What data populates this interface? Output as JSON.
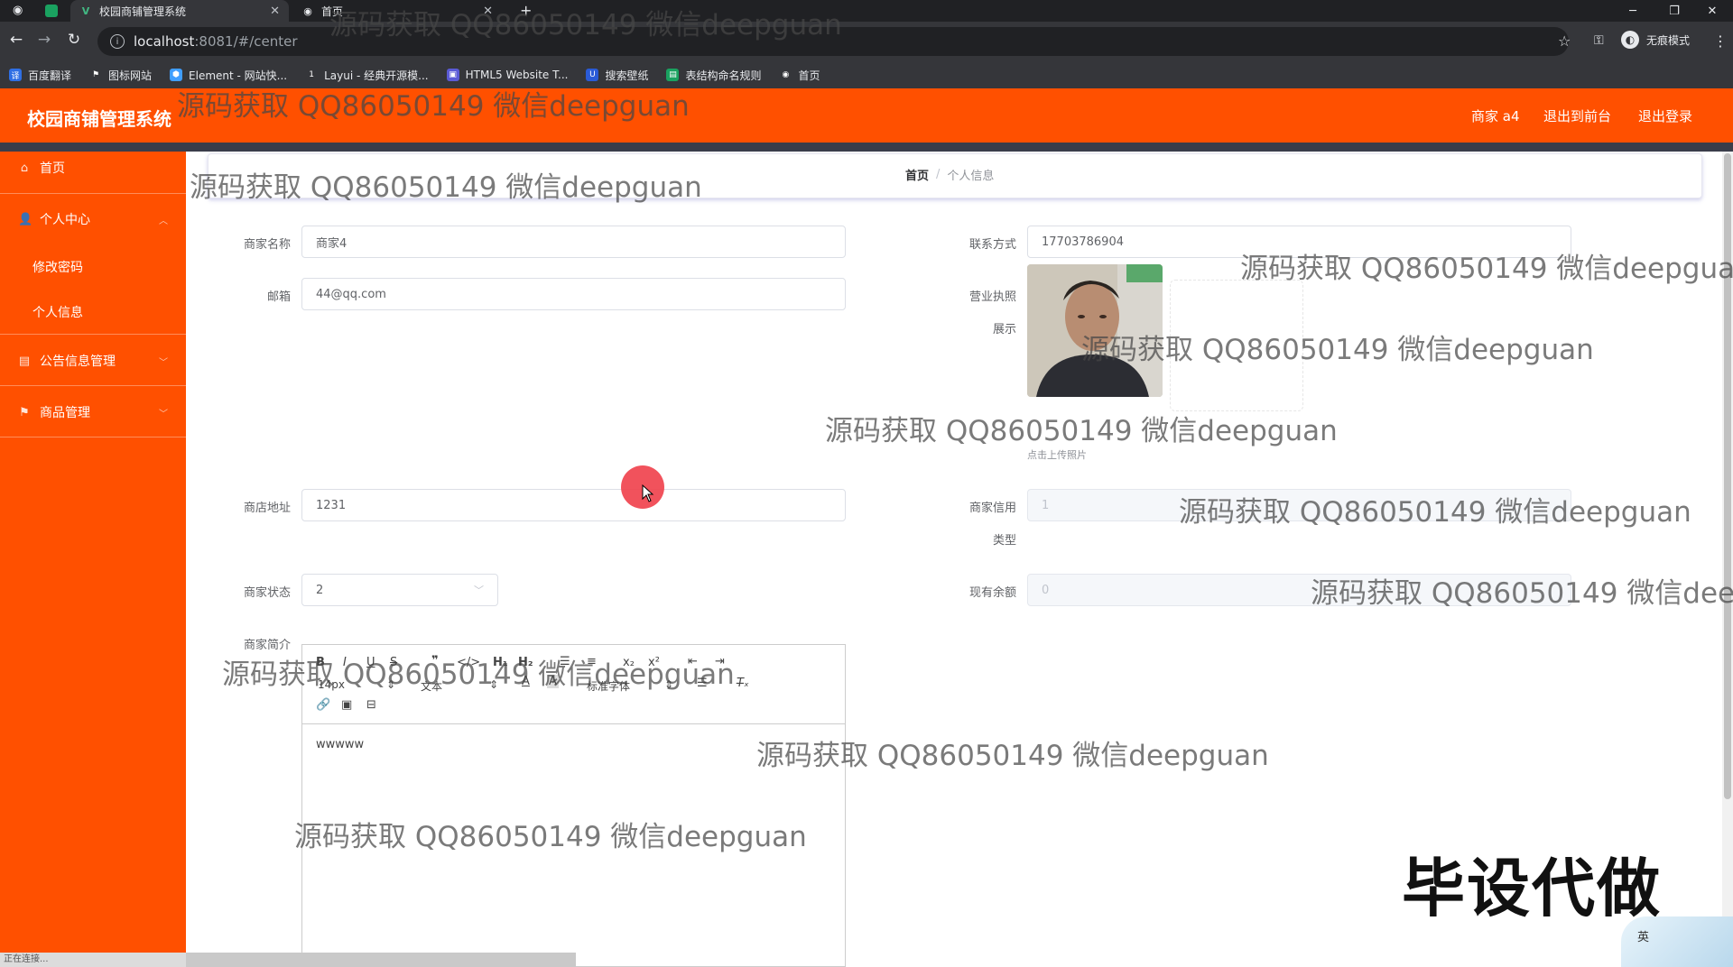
{
  "browser": {
    "tabs": [
      {
        "title": "校园商铺管理系统",
        "active": true
      },
      {
        "title": "首页",
        "active": false
      }
    ],
    "new_tab": "+",
    "url_host": "localhost",
    "url_path": ":8081/#/center",
    "profile_label": "无痕模式",
    "bookmarks": [
      "百度翻译",
      "图标网站",
      "Element - 网站快...",
      "Layui - 经典开源模...",
      "HTML5 Website T...",
      "搜索壁纸",
      "表结构命名规则",
      "首页"
    ],
    "status_text": "正在连接..."
  },
  "header": {
    "title": "校园商铺管理系统",
    "user": "商家 a4",
    "back_front": "退出到前台",
    "logout": "退出登录"
  },
  "sidebar": {
    "home": "首页",
    "personal_center": "个人中心",
    "change_password": "修改密码",
    "personal_info": "个人信息",
    "notice_mgmt": "公告信息管理",
    "product_mgmt": "商品管理"
  },
  "breadcrumb": {
    "root": "首页",
    "sep": "/",
    "current": "个人信息"
  },
  "form": {
    "merchant_name": {
      "label": "商家名称",
      "value": "商家4"
    },
    "contact": {
      "label": "联系方式",
      "value": "17703786904"
    },
    "email": {
      "label": "邮箱",
      "value": "44@qq.com"
    },
    "license": {
      "label_line1": "营业执照",
      "label_line2": "展示",
      "upload_tip": "点击上传照片"
    },
    "address": {
      "label": "商店地址",
      "value": "1231"
    },
    "credit": {
      "label_line1": "商家信用",
      "label_line2": "类型",
      "value": "1"
    },
    "status": {
      "label": "商家状态",
      "value": "2"
    },
    "balance": {
      "label": "现有余额",
      "value": "0"
    },
    "intro": {
      "label": "商家简介",
      "content": "wwwww"
    }
  },
  "editor": {
    "font_size": "14px",
    "text_type": "文本",
    "font_family": "标准字体"
  },
  "overlays": {
    "watermark": "源码获取 QQ86050149 微信deepguan",
    "badge": "毕设代做",
    "ime": "英"
  },
  "colors": {
    "brand": "#ff5000",
    "header_shadow": "#3a3d4a"
  }
}
